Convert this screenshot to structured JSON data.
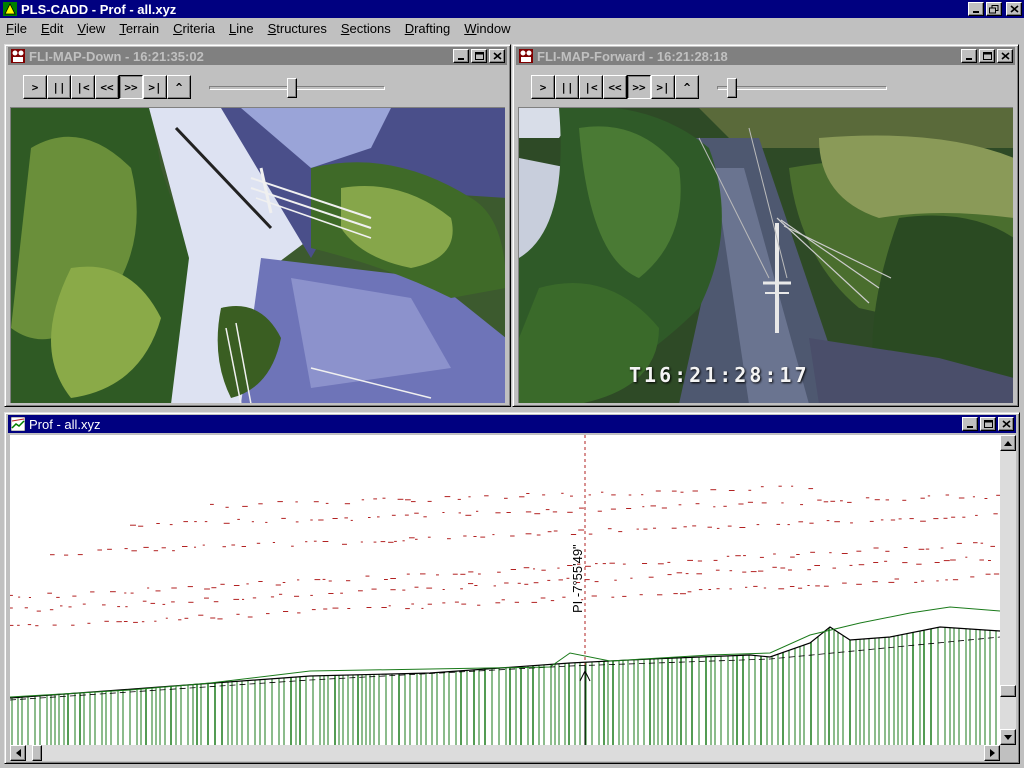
{
  "app": {
    "title": "PLS-CADD - Prof - all.xyz"
  },
  "menu": [
    {
      "label": "File",
      "key": "F"
    },
    {
      "label": "Edit",
      "key": "E"
    },
    {
      "label": "View",
      "key": "V"
    },
    {
      "label": "Terrain",
      "key": "T"
    },
    {
      "label": "Criteria",
      "key": "C"
    },
    {
      "label": "Line",
      "key": "L"
    },
    {
      "label": "Structures",
      "key": "S"
    },
    {
      "label": "Sections",
      "key": "S"
    },
    {
      "label": "Drafting",
      "key": "D"
    },
    {
      "label": "Window",
      "key": "W"
    }
  ],
  "video_down": {
    "title": "FLI-MAP-Down - 16:21:35:02",
    "controls": [
      ">",
      "||",
      "|<",
      "<<",
      ">>",
      ">|",
      "^"
    ],
    "pressed": ">>",
    "slider_position": 0.47
  },
  "video_forward": {
    "title": "FLI-MAP-Forward - 16:21:28:18",
    "timestamp": "T16:21:28:17",
    "controls": [
      ">",
      "||",
      "|<",
      "<<",
      ">>",
      ">|",
      "^"
    ],
    "pressed": ">>",
    "slider_position": 0.06
  },
  "profile": {
    "title": "Prof - all.xyz",
    "pi_label": "PI -7°55'49\""
  },
  "colors": {
    "title_active": "#000080",
    "title_inactive": "#808080",
    "ground_green": "#1a7a1a",
    "points_red": "#b22222"
  }
}
